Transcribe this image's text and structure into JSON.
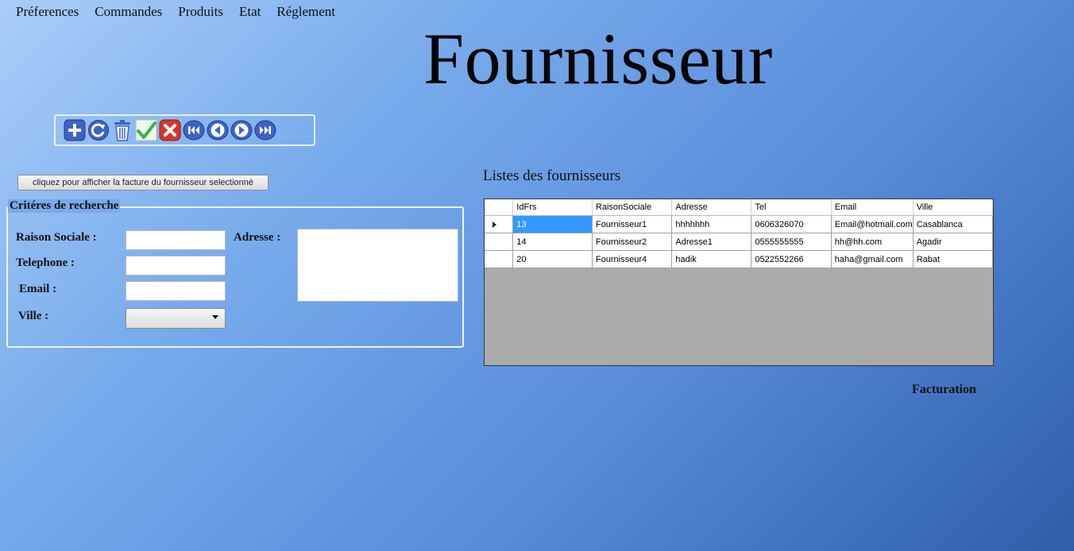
{
  "menu": [
    "Préferences",
    "Commandes",
    "Produits",
    "Etat",
    "Réglement"
  ],
  "title": "Fournisseur",
  "toolbar": {
    "icons": [
      "add-icon",
      "refresh-icon",
      "trash-icon",
      "check-icon",
      "cancel-icon",
      "first-icon",
      "previous-icon",
      "next-icon",
      "last-icon"
    ]
  },
  "facture_button": "cliquez pour afficher la facture du fournisseur selectionné",
  "search": {
    "legend": "Critéres de recherche",
    "raison_label": "Raison Sociale :",
    "telephone_label": "Telephone :",
    "email_label": "Email :",
    "ville_label": "Ville :",
    "adresse_label": "Adresse :",
    "raison_value": "",
    "telephone_value": "",
    "email_value": "",
    "adresse_value": "",
    "ville_value": ""
  },
  "list": {
    "title": "Listes des fournisseurs",
    "columns": [
      "IdFrs",
      "RaisonSociale",
      "Adresse",
      "Tel",
      "Email",
      "Ville"
    ],
    "rows": [
      [
        "13",
        "Fournisseur1",
        "hhhhhhh",
        "0606326070",
        "Email@hotmail.com",
        "Casablanca"
      ],
      [
        "14",
        "Fournisseur2",
        "Adresse1",
        "0555555555",
        "hh@hh.com",
        "Agadir"
      ],
      [
        "20",
        "Fournisseur4",
        "hadik",
        "0522552266",
        "haha@gmail.com",
        "Rabat"
      ]
    ]
  },
  "facturation": "Facturation",
  "colors": {
    "button_blue": "#3f63c4",
    "check_green": "#3bb54a",
    "cancel_red": "#d9342b",
    "selection": "#3399ff"
  }
}
